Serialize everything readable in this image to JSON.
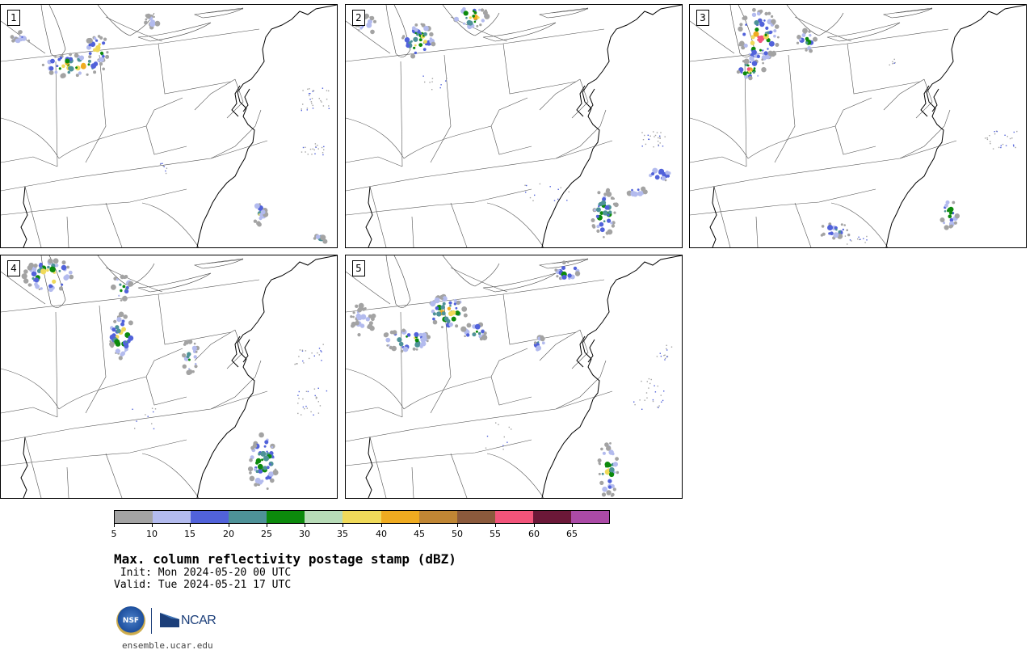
{
  "figure": {
    "title": "Max. column reflectivity postage stamp (dBZ)",
    "init": " Init: Mon 2024-05-20 00 UTC",
    "valid": "Valid: Tue 2024-05-21 17 UTC",
    "footer_url": "ensemble.ucar.edu",
    "logo_nsf": "NSF",
    "logo_ncar": "NCAR"
  },
  "panels": [
    {
      "label": "1"
    },
    {
      "label": "2"
    },
    {
      "label": "3"
    },
    {
      "label": "4"
    },
    {
      "label": "5"
    }
  ],
  "colorbar": {
    "tick_labels": [
      "5",
      "10",
      "15",
      "20",
      "25",
      "30",
      "35",
      "40",
      "45",
      "50",
      "55",
      "60",
      "65"
    ],
    "colors": [
      "#a3a3a3",
      "#b3bbee",
      "#5162da",
      "#4e9298",
      "#0c8a0c",
      "#b8dcb8",
      "#f0da5a",
      "#efab20",
      "#c08634",
      "#8b5a3c",
      "#f2547a",
      "#6b1838",
      "#ab4aa6"
    ]
  },
  "map": {
    "coast_color": "#000000",
    "border_color": "#555555",
    "precip_levels": [
      "#a3a3a3",
      "#b3bbee",
      "#5162da",
      "#4e9298",
      "#0c8a0c",
      "#f0da5a",
      "#efab20",
      "#f2547a"
    ]
  }
}
